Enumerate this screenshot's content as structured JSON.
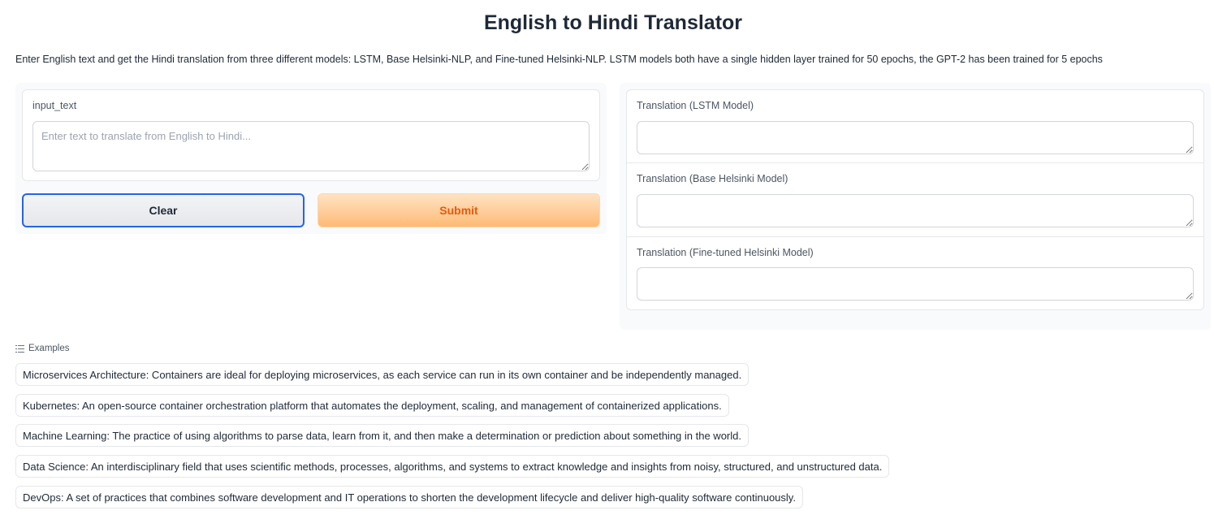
{
  "header": {
    "title": "English to Hindi Translator",
    "description": "Enter English text and get the Hindi translation from three different models: LSTM, Base Helsinki-NLP, and Fine-tuned Helsinki-NLP. LSTM models both have a single hidden layer trained for 50 epochs, the GPT-2 has been trained for 5 epochs"
  },
  "input": {
    "label": "input_text",
    "value": "",
    "placeholder": "Enter text to translate from English to Hindi..."
  },
  "buttons": {
    "clear_label": "Clear",
    "submit_label": "Submit"
  },
  "outputs": [
    {
      "label": "Translation (LSTM Model)",
      "value": ""
    },
    {
      "label": "Translation (Base Helsinki Model)",
      "value": ""
    },
    {
      "label": "Translation (Fine-tuned Helsinki Model)",
      "value": ""
    }
  ],
  "examples": {
    "header": "Examples",
    "icon": "list-icon",
    "items": [
      "Microservices Architecture: Containers are ideal for deploying microservices, as each service can run in its own container and be independently managed.",
      "Kubernetes: An open-source container orchestration platform that automates the deployment, scaling, and management of containerized applications.",
      "Machine Learning: The practice of using algorithms to parse data, learn from it, and then make a determination or prediction about something in the world.",
      "Data Science: An interdisciplinary field that uses scientific methods, processes, algorithms, and systems to extract knowledge and insights from noisy, structured, and unstructured data.",
      "DevOps: A set of practices that combines software development and IT operations to shorten the development lifecycle and deliver high-quality software continuously."
    ]
  },
  "colors": {
    "submit_text": "#ea580c",
    "submit_bg": "#fdba74",
    "clear_border": "#2563eb"
  }
}
